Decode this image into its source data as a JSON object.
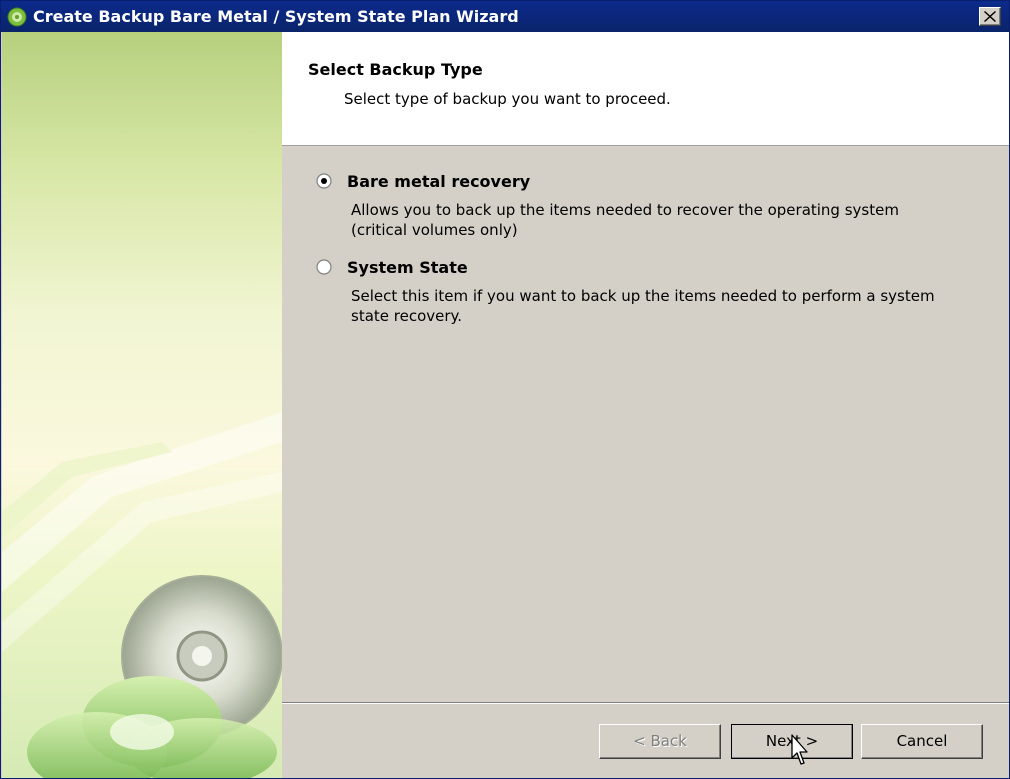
{
  "window": {
    "title": "Create Backup Bare Metal / System State Plan Wizard"
  },
  "header": {
    "title": "Select Backup Type",
    "subtitle": "Select type of backup you want to proceed."
  },
  "options": [
    {
      "label": "Bare metal recovery",
      "description": "Allows you to back up the items needed to recover the operating system (critical volumes only)",
      "selected": true
    },
    {
      "label": "System State",
      "description": "Select this item if you want to back up the items needed to perform a system state recovery.",
      "selected": false
    }
  ],
  "buttons": {
    "back": "< Back",
    "next": "Next >",
    "cancel": "Cancel"
  },
  "icons": {
    "app": "backup-app-icon",
    "close": "close-icon",
    "sidebar_art": "cd-disc-icon",
    "cursor": "mouse-cursor-icon"
  },
  "colors": {
    "titlebar": "#0a246a",
    "dialog_face": "#d4d0c8",
    "header_bg": "#ffffff",
    "sidebar_green": "#b6d07e"
  }
}
